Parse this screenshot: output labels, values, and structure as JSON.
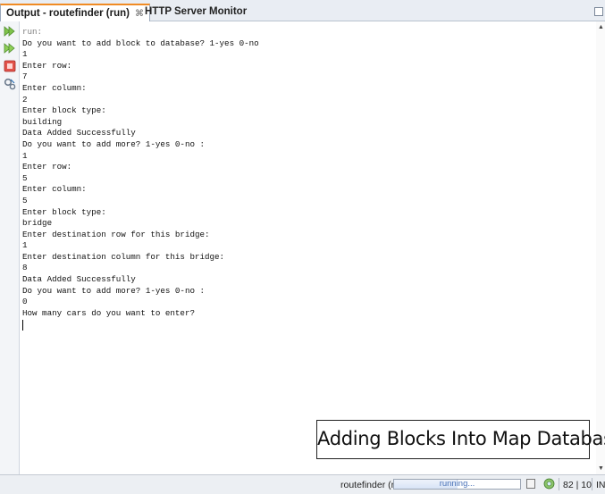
{
  "tabs": [
    {
      "label": "Output - routefinder (run)",
      "close": "⌘"
    },
    {
      "label": "HTTP Server Monitor"
    }
  ],
  "gutter_icons": [
    "rerun-icon",
    "rerun-with-options-icon",
    "stop-icon",
    "settings-icon"
  ],
  "console_lines": [
    "run:",
    "Do you want to add block to database? 1-yes 0-no",
    "1",
    "Enter row:",
    "7",
    "Enter column:",
    "2",
    "Enter block type:",
    "building",
    "Data Added Successfully",
    "Do you want to add more? 1-yes 0-no :",
    "1",
    "Enter row:",
    "5",
    "Enter column:",
    "5",
    "Enter block type:",
    "bridge",
    "Enter destination row for this bridge:",
    "1",
    "Enter destination column for this bridge:",
    "8",
    "Data Added Successfully",
    "Do you want to add more? 1-yes 0-no :",
    "0",
    "How many cars do you want to enter?"
  ],
  "caption": "Adding Blocks Into Map Database",
  "status": {
    "task": "routefinder (run)",
    "progress_text": "running...",
    "progress_fraction": 0.5,
    "position": "82 | 10",
    "mode": "INS"
  },
  "colors": {
    "accent_tab": "#f08b24",
    "progress_text": "#4a73b8",
    "run_dim": "#7f7f7f"
  }
}
